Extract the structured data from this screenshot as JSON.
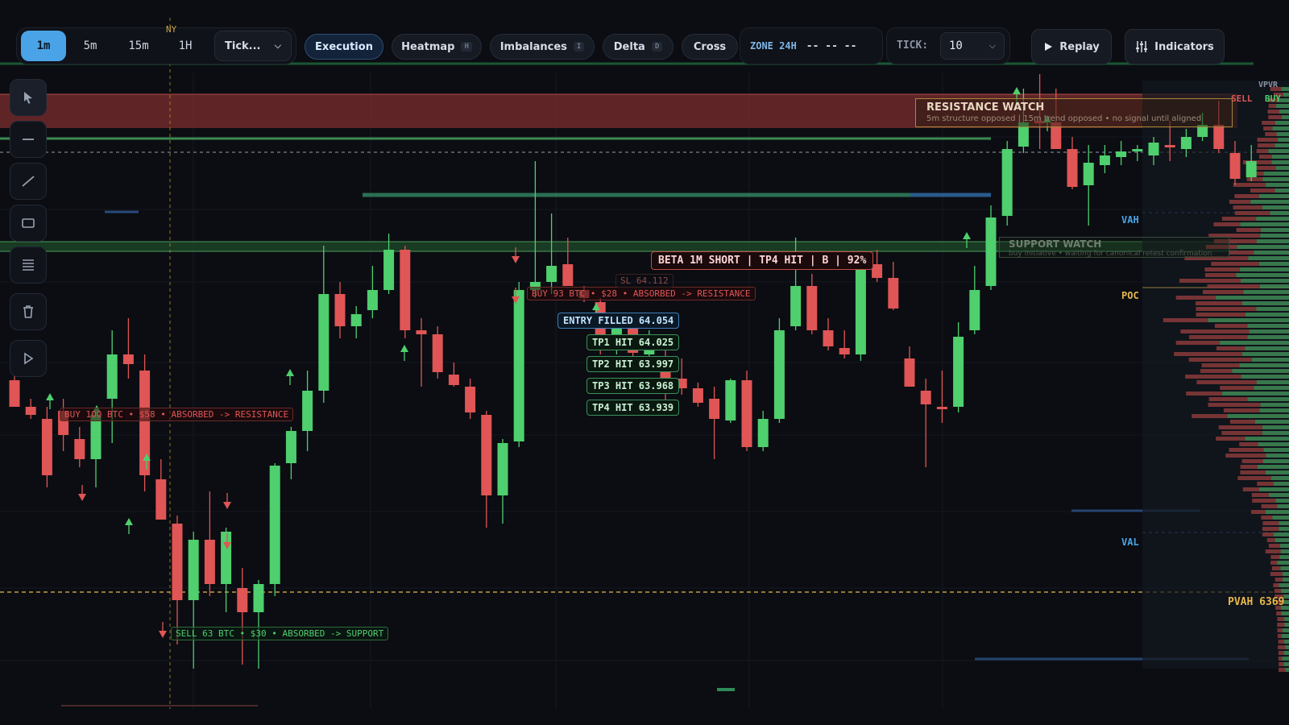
{
  "timeframes": [
    "1m",
    "5m",
    "15m",
    "1H"
  ],
  "active_timeframe": "1m",
  "session_marker": "NY",
  "tick_select": "Tick...",
  "toggles": [
    {
      "label": "Execution",
      "key": ""
    },
    {
      "label": "Heatmap",
      "key": "H"
    },
    {
      "label": "Imbalances",
      "key": "I"
    },
    {
      "label": "Delta",
      "key": "D"
    },
    {
      "label": "Cross",
      "key": ""
    }
  ],
  "zone": {
    "label": "ZONE 24H",
    "value": "-- -- --"
  },
  "tick": {
    "label": "TICK:",
    "value": "10"
  },
  "replay_label": "Replay",
  "indicators_label": "Indicators",
  "icons": {
    "tools": [
      "cursor-icon",
      "horizontal-line-icon",
      "trend-line-icon",
      "rectangle-icon",
      "fib-lines-icon",
      "trash-icon",
      "play-icon"
    ],
    "replay": "play-icon",
    "indicators": "sliders-icon",
    "dropdown": "chevron-down-icon"
  },
  "resistance_zone": {
    "title": "RESISTANCE WATCH",
    "subtitle": "5m structure opposed | 15m trend opposed • no signal until aligned"
  },
  "support_zone": {
    "title": "SUPPORT WATCH",
    "subtitle": "buy initiative • waiting for canonical retest confirmation"
  },
  "profile_labels": {
    "vpvr": "VPVR",
    "sell": "SELL",
    "buy": "BUY",
    "vah": "VAH",
    "poc": "POC",
    "val": "VAL",
    "pvah": "PVAH 6369"
  },
  "absorptions": [
    {
      "text": "BUY 100 BTC • $58 • ABSORBED -> RESISTANCE"
    },
    {
      "text": "BUY 93 BTC • $28 • ABSORBED -> RESISTANCE"
    },
    {
      "text": "SELL 63 BTC • $30 • ABSORBED -> SUPPORT"
    }
  ],
  "trade": {
    "signal": "BETA 1M SHORT | TP4 HIT | B | 92%",
    "sl": "SL 64.112",
    "entry": "ENTRY FILLED 64.054",
    "targets": [
      "TP1 HIT 64.025",
      "TP2 HIT 63.997",
      "TP3 HIT 63.968",
      "TP4 HIT 63.939"
    ]
  },
  "colors": {
    "bull": "#4fcf6e",
    "bear": "#e05555",
    "accent": "#4aa3e6",
    "gold": "#e6b84a",
    "bg": "#0b0d12"
  },
  "candles": [
    {
      "o": 472,
      "h": 460,
      "l": 480,
      "c": 505
    },
    {
      "o": 505,
      "h": 495,
      "l": 520,
      "c": 515
    },
    {
      "o": 520,
      "h": 505,
      "l": 605,
      "c": 590
    },
    {
      "o": 510,
      "h": 495,
      "l": 560,
      "c": 540
    },
    {
      "o": 545,
      "h": 530,
      "l": 580,
      "c": 570
    },
    {
      "o": 570,
      "h": 510,
      "l": 605,
      "c": 515
    },
    {
      "o": 495,
      "h": 410,
      "l": 550,
      "c": 440
    },
    {
      "o": 440,
      "h": 395,
      "l": 470,
      "c": 452
    },
    {
      "o": 460,
      "h": 440,
      "l": 610,
      "c": 590
    },
    {
      "o": 595,
      "h": 570,
      "l": 620,
      "c": 645
    },
    {
      "o": 650,
      "h": 640,
      "l": 800,
      "c": 745
    },
    {
      "o": 745,
      "h": 660,
      "l": 830,
      "c": 670
    },
    {
      "o": 670,
      "h": 610,
      "l": 740,
      "c": 725
    },
    {
      "o": 725,
      "h": 655,
      "l": 760,
      "c": 660
    },
    {
      "o": 730,
      "h": 705,
      "l": 825,
      "c": 760
    },
    {
      "o": 760,
      "h": 720,
      "l": 830,
      "c": 725
    },
    {
      "o": 725,
      "h": 575,
      "l": 740,
      "c": 578
    },
    {
      "o": 575,
      "h": 530,
      "l": 595,
      "c": 535
    },
    {
      "o": 535,
      "h": 460,
      "l": 560,
      "c": 485
    },
    {
      "o": 485,
      "h": 305,
      "l": 500,
      "c": 365
    },
    {
      "o": 365,
      "h": 350,
      "l": 420,
      "c": 405
    },
    {
      "o": 405,
      "h": 380,
      "l": 420,
      "c": 390
    },
    {
      "o": 385,
      "h": 330,
      "l": 395,
      "c": 360
    },
    {
      "o": 360,
      "h": 290,
      "l": 365,
      "c": 310
    },
    {
      "o": 310,
      "h": 305,
      "l": 420,
      "c": 410
    },
    {
      "o": 410,
      "h": 395,
      "l": 480,
      "c": 415
    },
    {
      "o": 415,
      "h": 405,
      "l": 470,
      "c": 462
    },
    {
      "o": 465,
      "h": 450,
      "l": 480,
      "c": 478
    },
    {
      "o": 480,
      "h": 470,
      "l": 520,
      "c": 512
    },
    {
      "o": 515,
      "h": 510,
      "l": 655,
      "c": 615
    },
    {
      "o": 615,
      "h": 545,
      "l": 650,
      "c": 550
    },
    {
      "o": 548,
      "h": 350,
      "l": 555,
      "c": 360
    },
    {
      "o": 360,
      "h": 200,
      "l": 370,
      "c": 350
    },
    {
      "o": 350,
      "h": 265,
      "l": 365,
      "c": 330
    },
    {
      "o": 328,
      "h": 295,
      "l": 355,
      "c": 355
    },
    {
      "o": 360,
      "h": 355,
      "l": 375,
      "c": 370
    },
    {
      "o": 375,
      "h": 370,
      "l": 440,
      "c": 435
    },
    {
      "o": 432,
      "h": 400,
      "l": 440,
      "c": 405
    },
    {
      "o": 405,
      "h": 390,
      "l": 445,
      "c": 438
    },
    {
      "o": 440,
      "h": 410,
      "l": 450,
      "c": 415
    },
    {
      "o": 445,
      "h": 430,
      "l": 505,
      "c": 470
    },
    {
      "o": 470,
      "h": 445,
      "l": 490,
      "c": 482
    },
    {
      "o": 482,
      "h": 475,
      "l": 505,
      "c": 500
    },
    {
      "o": 495,
      "h": 480,
      "l": 570,
      "c": 520
    },
    {
      "o": 522,
      "h": 470,
      "l": 525,
      "c": 472
    },
    {
      "o": 472,
      "h": 460,
      "l": 560,
      "c": 555
    },
    {
      "o": 555,
      "h": 510,
      "l": 560,
      "c": 520
    },
    {
      "o": 520,
      "h": 395,
      "l": 525,
      "c": 410
    },
    {
      "o": 405,
      "h": 295,
      "l": 410,
      "c": 355
    },
    {
      "o": 355,
      "h": 340,
      "l": 415,
      "c": 410
    },
    {
      "o": 410,
      "h": 395,
      "l": 435,
      "c": 430
    },
    {
      "o": 432,
      "h": 410,
      "l": 445,
      "c": 440
    },
    {
      "o": 440,
      "h": 325,
      "l": 448,
      "c": 330
    },
    {
      "o": 328,
      "h": 310,
      "l": 350,
      "c": 345
    },
    {
      "o": 345,
      "h": 325,
      "l": 385,
      "c": 383
    },
    {
      "o": 445,
      "h": 430,
      "l": 480,
      "c": 480
    },
    {
      "o": 485,
      "h": 470,
      "l": 580,
      "c": 502
    },
    {
      "o": 505,
      "h": 460,
      "l": 525,
      "c": 508
    },
    {
      "o": 505,
      "h": 400,
      "l": 512,
      "c": 418
    },
    {
      "o": 410,
      "h": 330,
      "l": 415,
      "c": 360
    },
    {
      "o": 355,
      "h": 255,
      "l": 360,
      "c": 270
    },
    {
      "o": 268,
      "h": 175,
      "l": 280,
      "c": 185
    },
    {
      "o": 182,
      "h": 110,
      "l": 190,
      "c": 152
    },
    {
      "o": 150,
      "h": 92,
      "l": 185,
      "c": 152
    },
    {
      "o": 152,
      "h": 110,
      "l": 185,
      "c": 185
    },
    {
      "o": 185,
      "h": 170,
      "l": 235,
      "c": 232
    },
    {
      "o": 230,
      "h": 180,
      "l": 280,
      "c": 202
    },
    {
      "o": 205,
      "h": 180,
      "l": 215,
      "c": 193
    },
    {
      "o": 195,
      "h": 175,
      "l": 205,
      "c": 188
    },
    {
      "o": 188,
      "h": 180,
      "l": 200,
      "c": 185
    },
    {
      "o": 193,
      "h": 170,
      "l": 205,
      "c": 177
    },
    {
      "o": 180,
      "h": 150,
      "l": 200,
      "c": 180
    },
    {
      "o": 185,
      "h": 160,
      "l": 195,
      "c": 170
    },
    {
      "o": 170,
      "h": 140,
      "l": 175,
      "c": 155
    },
    {
      "o": 155,
      "h": 125,
      "l": 190,
      "c": 185
    },
    {
      "o": 190,
      "h": 175,
      "l": 230,
      "c": 222
    },
    {
      "o": 220,
      "h": 180,
      "l": 225,
      "c": 200
    }
  ]
}
